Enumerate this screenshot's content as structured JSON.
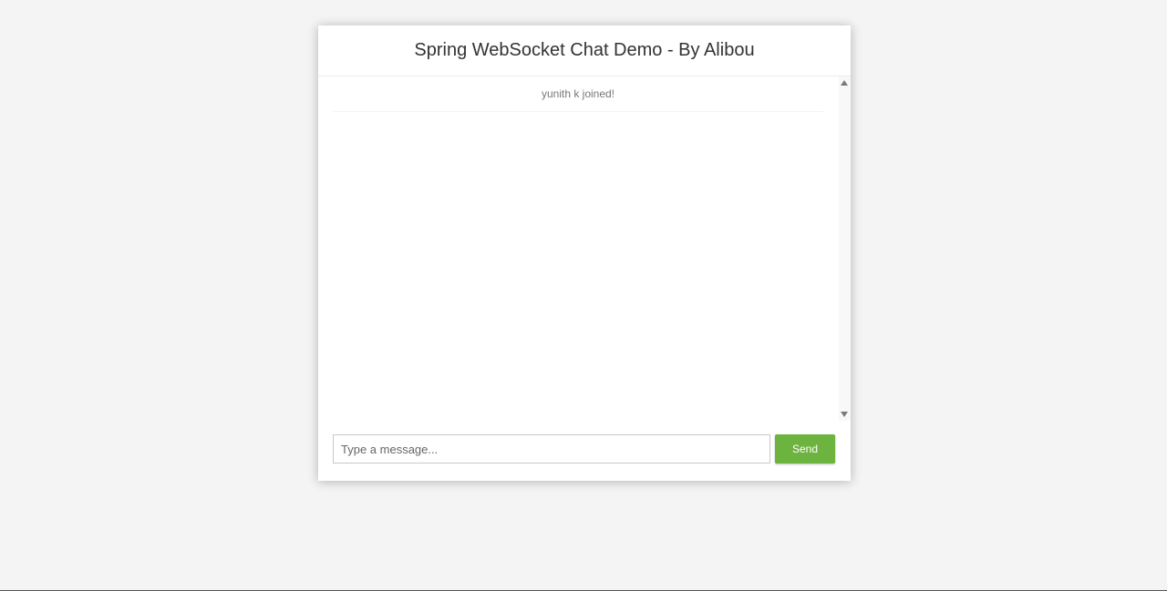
{
  "header": {
    "title": "Spring WebSocket Chat Demo - By Alibou"
  },
  "messages": [
    {
      "type": "event",
      "text": "yunith k joined!"
    }
  ],
  "form": {
    "input_placeholder": "Type a message...",
    "input_value": "",
    "send_label": "Send"
  },
  "colors": {
    "send_button": "#6db33f",
    "page_background": "#f4f4f4"
  }
}
